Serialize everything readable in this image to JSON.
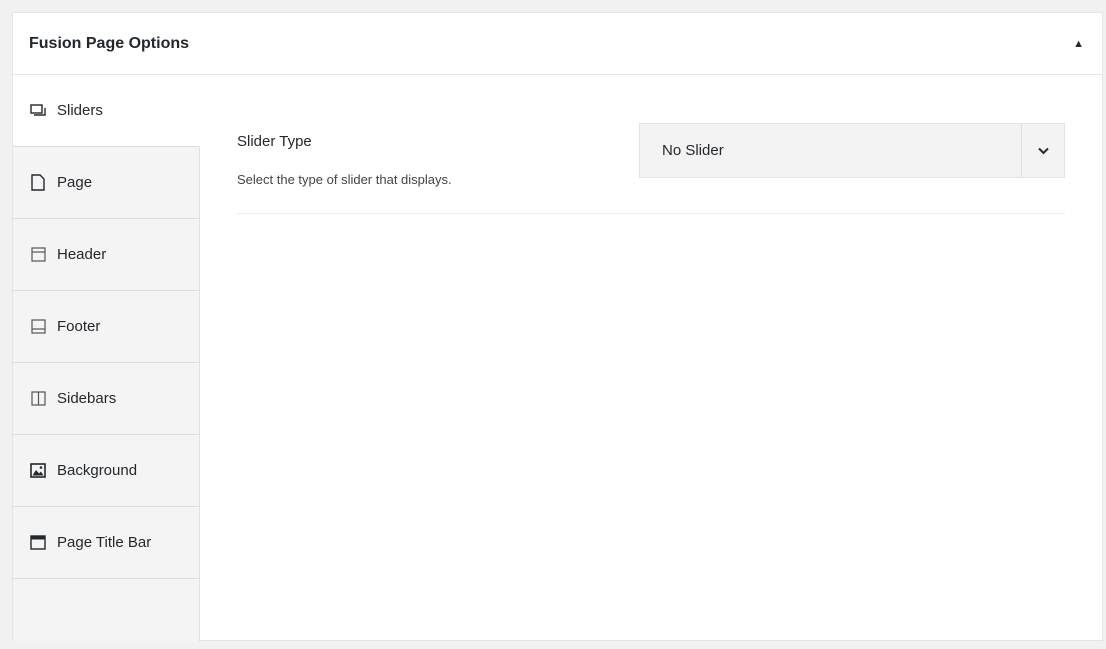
{
  "panel": {
    "title": "Fusion Page Options",
    "toggle_icon": "▲"
  },
  "tabs": [
    {
      "label": "Sliders",
      "icon": "sliders-icon",
      "active": true
    },
    {
      "label": "Page",
      "icon": "page-icon",
      "active": false
    },
    {
      "label": "Header",
      "icon": "header-icon",
      "active": false
    },
    {
      "label": "Footer",
      "icon": "footer-icon",
      "active": false
    },
    {
      "label": "Sidebars",
      "icon": "sidebars-icon",
      "active": false
    },
    {
      "label": "Background",
      "icon": "background-icon",
      "active": false
    },
    {
      "label": "Page Title Bar",
      "icon": "page-title-bar-icon",
      "active": false
    }
  ],
  "field": {
    "label": "Slider Type",
    "description": "Select the type of slider that displays.",
    "selected_value": "No Slider",
    "arrow_icon": "chevron-down-icon"
  }
}
